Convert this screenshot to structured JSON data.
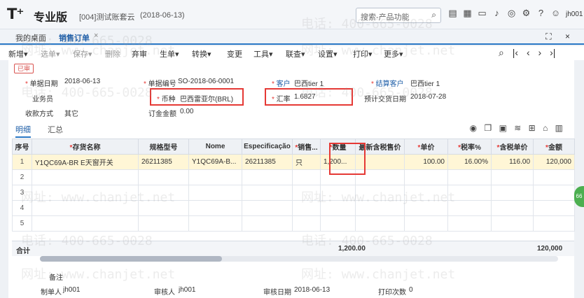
{
  "app": {
    "logo": "T⁺",
    "name": "专业版",
    "account": "[004]测试账套云",
    "date": "(2018-06-13)",
    "search_placeholder": "搜索-产品功能",
    "user": "jh001"
  },
  "tabs": {
    "desk": "我的桌面",
    "active": "销售订单"
  },
  "toolbar": {
    "items": [
      "新增",
      "选单",
      "保存",
      "删除",
      "弃审",
      "生单",
      "转换",
      "变更",
      "工具",
      "联查",
      "设置",
      "打印",
      "更多"
    ]
  },
  "header": {
    "status": "已审",
    "doc_date_label": "单据日期",
    "doc_date": "2018-06-13",
    "doc_no_label": "单据编号",
    "doc_no": "SO-2018-06-0001",
    "customer_label": "客户",
    "customer": "巴西tier 1",
    "settle_label": "结算客户",
    "settle": "巴西tier 1",
    "salesman_label": "业务员",
    "currency_label": "币种",
    "currency": "巴西雷亚尔(BRL)",
    "rate_label": "汇率",
    "rate": "1.6827",
    "delivery_label": "预计交货日期",
    "delivery": "2018-07-28",
    "receipt_label": "收款方式",
    "receipt": "其它",
    "deposit_label": "订金金额",
    "deposit": "0.00"
  },
  "subtabs": {
    "detail": "明细",
    "summary": "汇总"
  },
  "grid": {
    "headers": [
      "序号",
      "存货名称",
      "规格型号",
      "Nome",
      "Especificação",
      "销售...",
      "数量",
      "最新含税售价",
      "单价",
      "税率%",
      "含税单价",
      "金额"
    ],
    "rows": [
      [
        "1",
        "Y1QC69A-BR E天窗开关",
        "26211385",
        "Y1QC69A-B...",
        "26211385",
        "只",
        "1,200...",
        "",
        "100.00",
        "16.00%",
        "116.00",
        "120,000"
      ],
      [
        "2",
        "",
        "",
        "",
        "",
        "",
        "",
        "",
        "",
        "",
        "",
        ""
      ],
      [
        "3",
        "",
        "",
        "",
        "",
        "",
        "",
        "",
        "",
        "",
        "",
        ""
      ],
      [
        "4",
        "",
        "",
        "",
        "",
        "",
        "",
        "",
        "",
        "",
        "",
        ""
      ],
      [
        "5",
        "",
        "",
        "",
        "",
        "",
        "",
        "",
        "",
        "",
        "",
        ""
      ]
    ],
    "total_label": "合计",
    "total_qty": "1,200.00",
    "total_amount": "120,000"
  },
  "footer": {
    "remark_label": "备注",
    "maker_label": "制单人",
    "maker": "jh001",
    "auditor_label": "审核人",
    "auditor": "jh001",
    "audit_date_label": "审核日期",
    "audit_date": "2018-06-13",
    "print_label": "打印次数",
    "print_count": "0"
  },
  "side_badge": "66",
  "watermark": {
    "phone": "电话: 400-665-0028",
    "site": "网址: www.chanjet.net"
  },
  "colors": {
    "accent": "#2a78c5",
    "highlight": "#e53935",
    "row_selected": "#fff6d6"
  }
}
